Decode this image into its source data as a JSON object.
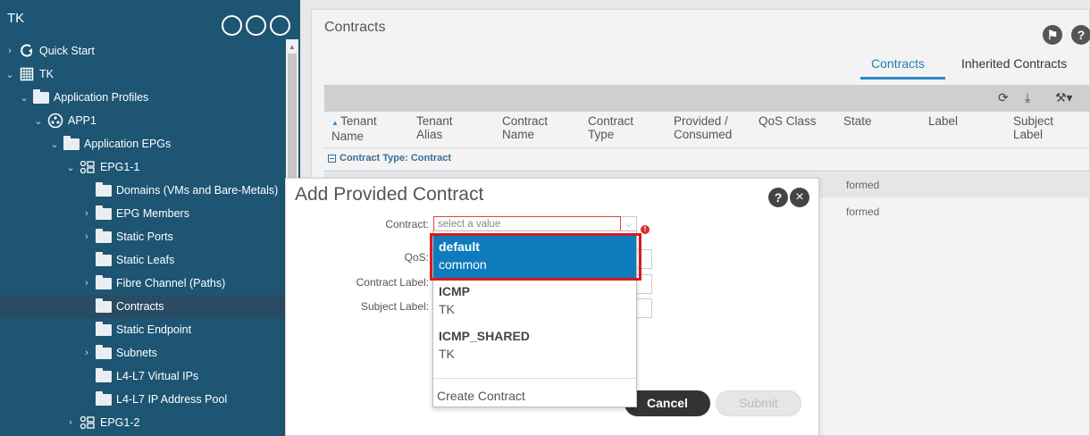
{
  "sidebar": {
    "title": "TK",
    "tree": [
      {
        "label": "Quick Start",
        "icon": "quick-start-icon"
      },
      {
        "label": "TK",
        "icon": "tenant-icon"
      },
      {
        "label": "Application Profiles",
        "icon": "folder-icon"
      },
      {
        "label": "APP1",
        "icon": "app-profile-icon"
      },
      {
        "label": "Application EPGs",
        "icon": "folder-icon"
      },
      {
        "label": "EPG1-1",
        "icon": "epg-icon"
      },
      {
        "label": "Domains (VMs and Bare-Metals)",
        "icon": "folder-icon"
      },
      {
        "label": "EPG Members",
        "icon": "folder-icon"
      },
      {
        "label": "Static Ports",
        "icon": "folder-icon"
      },
      {
        "label": "Static Leafs",
        "icon": "folder-icon"
      },
      {
        "label": "Fibre Channel (Paths)",
        "icon": "folder-icon"
      },
      {
        "label": "Contracts",
        "icon": "folder-icon"
      },
      {
        "label": "Static Endpoint",
        "icon": "folder-icon"
      },
      {
        "label": "Subnets",
        "icon": "folder-icon"
      },
      {
        "label": "L4-L7 Virtual IPs",
        "icon": "folder-icon"
      },
      {
        "label": "L4-L7 IP Address Pool",
        "icon": "folder-icon"
      },
      {
        "label": "EPG1-2",
        "icon": "epg-icon"
      }
    ]
  },
  "main": {
    "title": "Contracts",
    "tabs": [
      "Contracts",
      "Inherited Contracts"
    ],
    "columns": [
      [
        "Tenant",
        "Name"
      ],
      [
        "Tenant",
        "Alias"
      ],
      [
        "Contract",
        "Name"
      ],
      [
        "Contract",
        "Type"
      ],
      [
        "Provided /",
        "Consumed"
      ],
      [
        "QoS Class",
        ""
      ],
      [
        "State",
        ""
      ],
      [
        "Label",
        ""
      ],
      [
        "Subject",
        "Label"
      ]
    ],
    "group_label": "Contract Type: Contract",
    "rows": [
      {
        "state": "formed"
      },
      {
        "state": "formed"
      }
    ]
  },
  "modal": {
    "title": "Add Provided Contract",
    "contract_label": "Contract:",
    "contract_placeholder": "select a value",
    "qos_label": "QoS:",
    "contract_label_label": "Contract Label:",
    "subject_label_label": "Subject Label:",
    "cancel": "Cancel",
    "submit": "Submit"
  },
  "dropdown": {
    "options": [
      {
        "name": "default",
        "tenant": "common"
      },
      {
        "name": "ICMP",
        "tenant": "TK"
      },
      {
        "name": "ICMP_SHARED",
        "tenant": "TK"
      }
    ],
    "create": "Create Contract"
  },
  "colors": {
    "sidebar": "#1d5573",
    "accent": "#0e7bbd",
    "highlight_frame": "#d71920"
  }
}
